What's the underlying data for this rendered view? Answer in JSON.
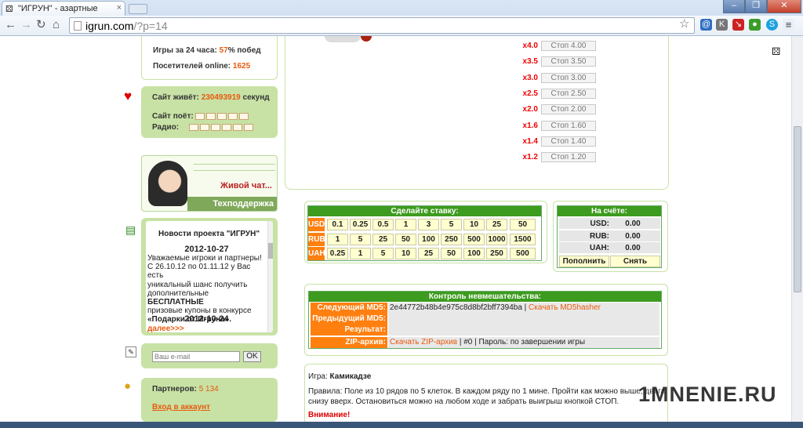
{
  "browser": {
    "tab_title": "\"ИГРУН\" - азартные",
    "tab_close": "×",
    "url_host": "igrun.com",
    "url_path": "/?p=14",
    "window_buttons": [
      "–",
      "❐",
      "✕"
    ],
    "icons": [
      "back-icon",
      "forward-icon",
      "home-icon",
      "star-icon",
      "extension-icons"
    ]
  },
  "sidebar": {
    "stats": {
      "games_label": "Игры за 24 часа:",
      "games_pct": "57",
      "games_suffix": "% побед",
      "visitors_label": "Посетителей online:",
      "visitors_count": "1625"
    },
    "alive": {
      "label": "Сайт живёт:",
      "seconds": "230493919",
      "suffix": "секунд",
      "sings_label": "Сайт поёт:",
      "radio_label": "Радио:"
    },
    "chat": {
      "live": "Живой чат...",
      "support": "Техподдержка"
    },
    "news": {
      "title": "Новости проекта \"ИГРУН\"",
      "date1": "2012-10-27",
      "l1": "Уважаемые игроки и партнеры!",
      "l2": "С 26.10.12 по 01.11.12 у Вас есть",
      "l3": "уникальный шанс получить",
      "l4a": "дополнительные ",
      "l4b": "БЕСПЛАТНЫЕ",
      "l5": "призовые купоны в конкурсе",
      "l6": "«Подарки от Игруна».",
      "more": "далее>>>",
      "date2": "2012-10-24"
    },
    "subscribe": {
      "placeholder": "Ваш e-mail",
      "ok": "OK"
    },
    "partners": {
      "label": "Партнеров:",
      "count": "5 134",
      "login": "Вход в аккаунт"
    }
  },
  "multipliers": [
    {
      "m": "x4.0",
      "stop": "Стоп 4.00"
    },
    {
      "m": "x3.5",
      "stop": "Стоп 3.50"
    },
    {
      "m": "x3.0",
      "stop": "Стоп 3.00"
    },
    {
      "m": "x2.5",
      "stop": "Стоп 2.50"
    },
    {
      "m": "x2.0",
      "stop": "Стоп 2.00"
    },
    {
      "m": "x1.6",
      "stop": "Стоп 1.60"
    },
    {
      "m": "x1.4",
      "stop": "Стоп 1.40"
    },
    {
      "m": "x1.2",
      "stop": "Стоп 1.20"
    }
  ],
  "bet": {
    "title": "Сделайте ставку:",
    "rows": [
      {
        "cur": "USD:",
        "vals": [
          "0.1",
          "0.25",
          "0.5",
          "1",
          "3",
          "5",
          "10",
          "25",
          "50"
        ]
      },
      {
        "cur": "RUB:",
        "vals": [
          "1",
          "5",
          "25",
          "50",
          "100",
          "250",
          "500",
          "1000",
          "1500"
        ]
      },
      {
        "cur": "UAH:",
        "vals": [
          "0.25",
          "1",
          "5",
          "10",
          "25",
          "50",
          "100",
          "250",
          "500"
        ]
      }
    ]
  },
  "account": {
    "title": "На счёте:",
    "rows": [
      {
        "c": "USD:",
        "v": "0.00"
      },
      {
        "c": "RUB:",
        "v": "0.00"
      },
      {
        "c": "UAH:",
        "v": "0.00"
      }
    ],
    "deposit": "Пополнить",
    "withdraw": "Снять"
  },
  "control": {
    "title": "Контроль невмешательства:",
    "next_label": "Следующий MD5:",
    "next_hash": "2e44772b48b4e975c8d8bf2bff7394ba",
    "sep": " | ",
    "hasher": "Скачать MD5hasher",
    "prev_label": "Предыдущий MD5:",
    "result_label": "Результат:",
    "zip_label": "ZIP-архив:",
    "zip_link": "Скачать ZIP-архив",
    "zip_info": " | #0 | Пароль: по завершении игры"
  },
  "game": {
    "label": "Игра:",
    "name": "Камикадзе",
    "rules1": "Правила: Поле из 10 рядов по 5 клеток. В каждом ряду по 1 мине. Пройти как можно выше, двигаясь",
    "rules2": "снизу вверх. Остановиться можно на любом ходе и забрать выигрыш кнопкой СТОП.",
    "attention": "Внимание!"
  },
  "watermark": "1MNENIE.RU"
}
